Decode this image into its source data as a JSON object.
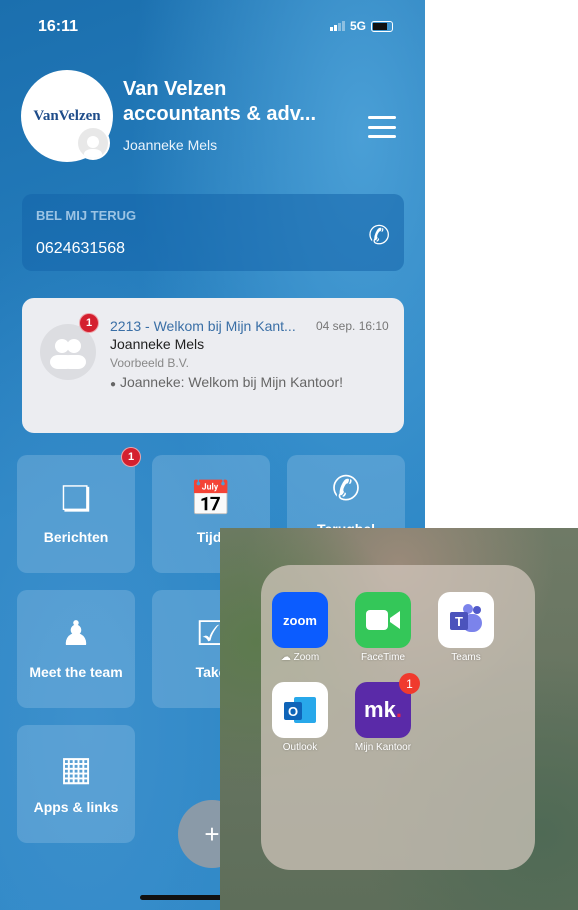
{
  "status": {
    "time": "16:11",
    "network": "5G"
  },
  "header": {
    "logo_text": "VanVelzen",
    "title": "Van Velzen accountants & adv...",
    "user": "Joanneke Mels",
    "menu_icon": "hamburger-icon"
  },
  "callback": {
    "label": "BEL MIJ TERUG",
    "number": "0624631568"
  },
  "message": {
    "badge": "1",
    "subject": "2213 - Welkom bij Mijn Kant...",
    "date": "04 sep. 16:10",
    "from": "Joanneke Mels",
    "org": "Voorbeeld B.V.",
    "preview": "Joanneke: Welkom bij Mijn Kantoor!"
  },
  "tiles": [
    {
      "label": "Berichten",
      "icon": "chat-bubbles-icon",
      "badge": "1"
    },
    {
      "label": "Tijdl",
      "icon": "calendar-icon"
    },
    {
      "label": "Terugbel",
      "icon": "phone-icon"
    },
    {
      "label": "Meet the team",
      "icon": "person-icon"
    },
    {
      "label": "Take",
      "icon": "checkbox-icon"
    },
    {
      "label": "Apps & links",
      "icon": "grid-icon"
    }
  ],
  "fab": {
    "label": "+"
  },
  "folder": {
    "apps": [
      {
        "name": "Zoom",
        "icon_text": "zoom",
        "color": "#0b5cff"
      },
      {
        "name": "FaceTime",
        "color": "#34c759"
      },
      {
        "name": "Teams",
        "icon_text": "T",
        "color": "#ffffff"
      },
      {
        "name": "Outlook",
        "icon_text": "O",
        "color": "#ffffff"
      },
      {
        "name": "Mijn Kantoor",
        "icon_text": "mk",
        "color": "#5a2aa8",
        "badge": "1"
      }
    ]
  }
}
